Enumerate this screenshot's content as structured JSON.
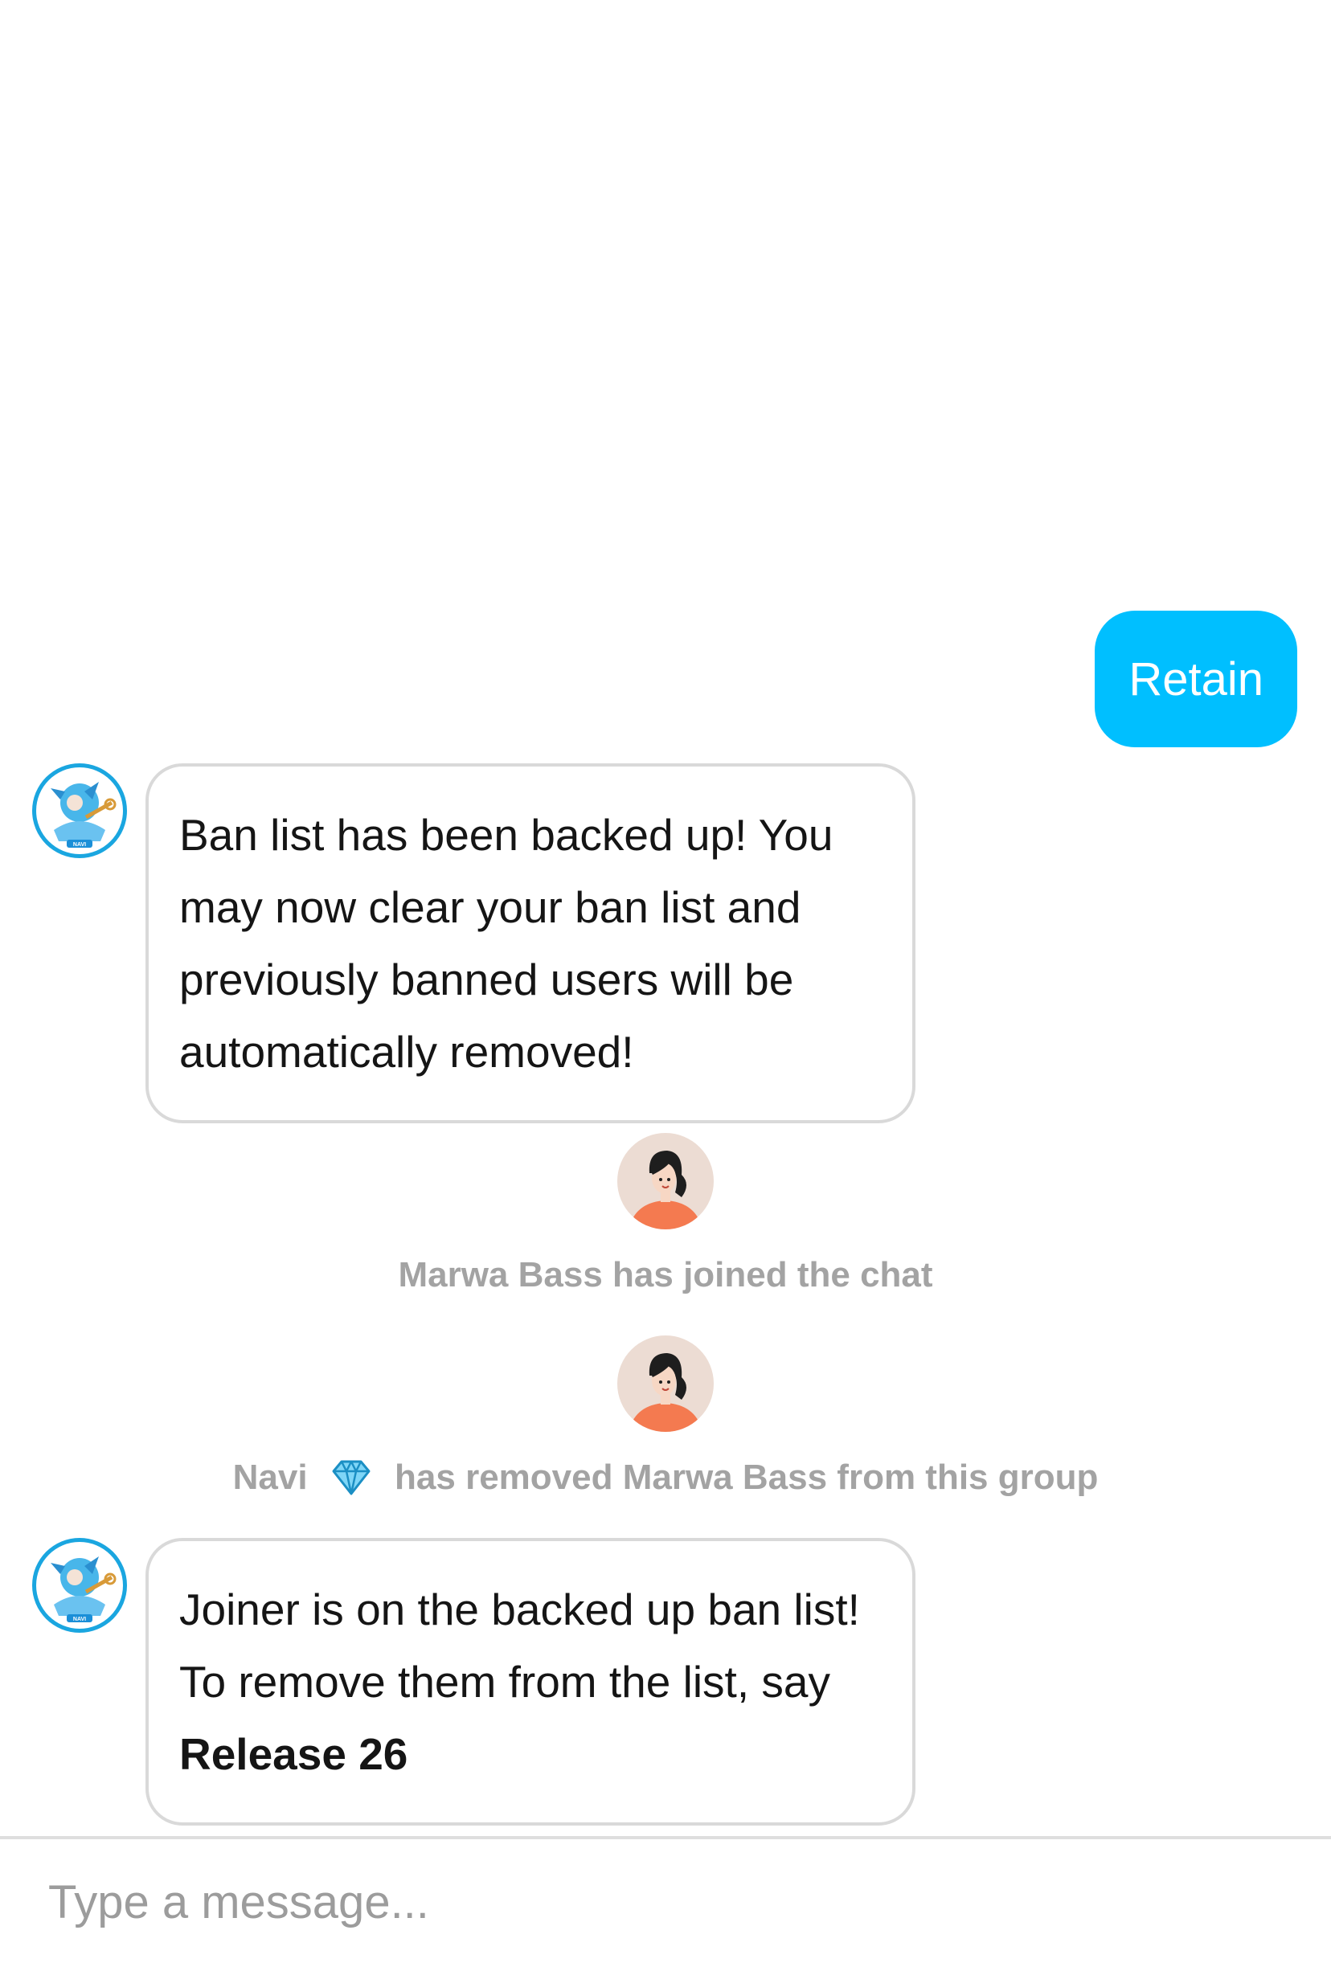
{
  "conversation": {
    "sent_message": "Retain",
    "bot_message_1": "Ban list has been backed up! You may now clear your ban list and previously banned users will be automatically removed!",
    "join_notice": "Marwa Bass has joined the chat",
    "removal_notice": {
      "actor": "Navi",
      "badge_icon": "diamond-icon",
      "text": "has removed Marwa Bass from this group"
    },
    "bot_message_2": {
      "text": "Joiner is on the backed up ban list! To remove them from the list, say",
      "command": "Release 26"
    }
  },
  "bot": {
    "avatar_label": "NAVI"
  },
  "composer": {
    "placeholder": "Type a message..."
  },
  "colors": {
    "sent_bubble": "#00bfff",
    "bubble_border": "#d9d9d9",
    "system_text": "#a3a3a3",
    "user_avatar_bg": "#ecdcd3",
    "user_shirt": "#f47a50",
    "bot_avatar_ring": "#1aa6e0"
  }
}
